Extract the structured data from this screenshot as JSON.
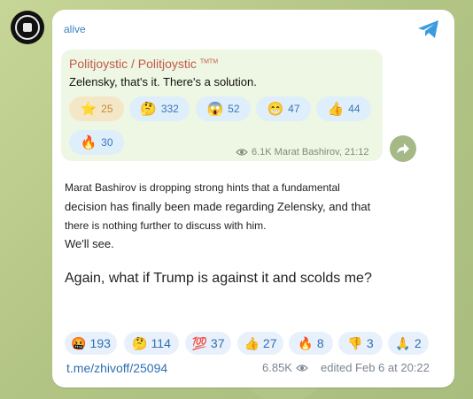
{
  "channel": {
    "name": "alive"
  },
  "forwarded": {
    "title": "Politjoystic / Politjoystic",
    "title_mark": "TMTM",
    "text": "Zelensky, that's it. There's a solution.",
    "reactions": [
      {
        "emoji": "⭐",
        "count": "25"
      },
      {
        "emoji": "🤔",
        "count": "332"
      },
      {
        "emoji": "😱",
        "count": "52"
      },
      {
        "emoji": "😁",
        "count": "47"
      },
      {
        "emoji": "👍",
        "count": "44"
      },
      {
        "emoji": "🔥",
        "count": "30"
      }
    ],
    "meta": "6.1K Marat Bashirov, 21:12"
  },
  "post": {
    "lines": [
      "Marat Bashirov is dropping strong hints that a fundamental",
      "decision has finally been made regarding Zelensky, and that",
      "there is nothing further to discuss with him.",
      "We'll see."
    ],
    "question": "Again, what if Trump is against it and scolds me?",
    "reactions": [
      {
        "emoji": "🤬",
        "count": "193"
      },
      {
        "emoji": "🤔",
        "count": "114"
      },
      {
        "emoji": "💯",
        "count": "37"
      },
      {
        "emoji": "👍",
        "count": "27"
      },
      {
        "emoji": "🔥",
        "count": "8"
      },
      {
        "emoji": "👎",
        "count": "3"
      },
      {
        "emoji": "🙏",
        "count": "2"
      }
    ],
    "link": "t.me/zhivoff/25094",
    "views": "6.85K",
    "edited": "edited  Feb 6 at 20:22"
  }
}
